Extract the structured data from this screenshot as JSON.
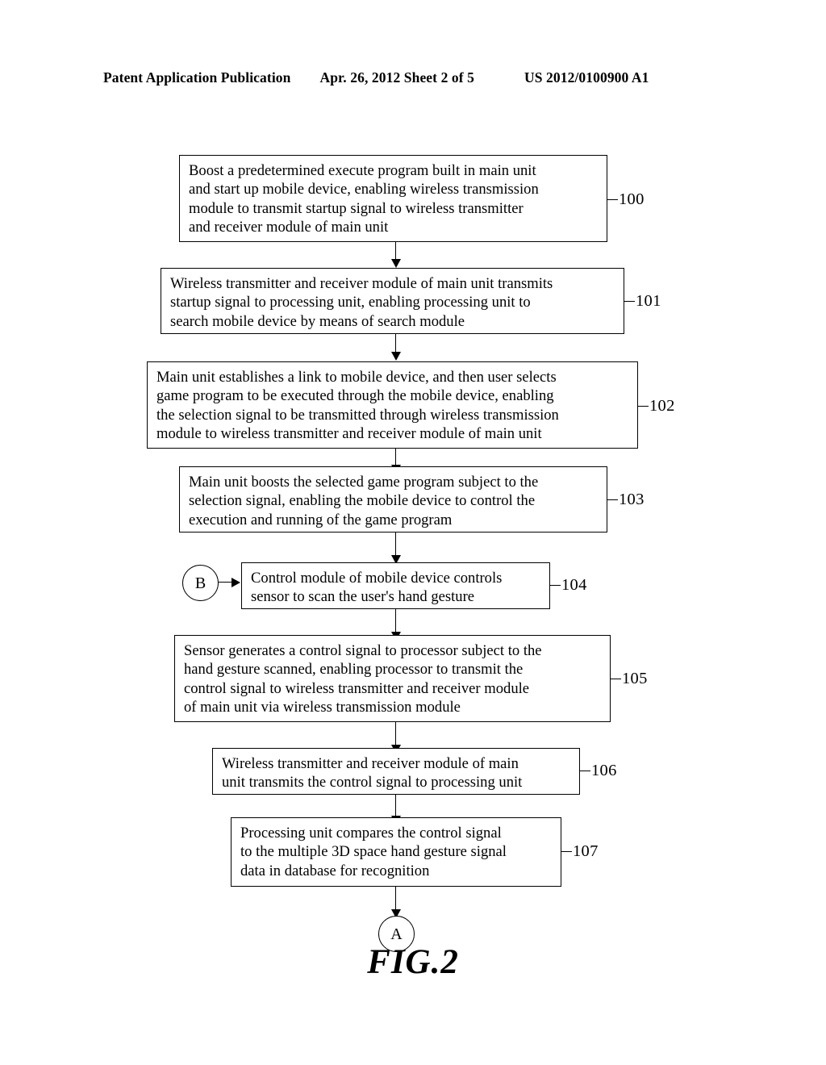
{
  "header": {
    "publication": "Patent Application Publication",
    "date_sheet": "Apr. 26, 2012  Sheet 2 of 5",
    "patent_number": "US 2012/0100900 A1"
  },
  "figure": {
    "caption": "FIG.2",
    "connector_in_label": "B",
    "connector_out_label": "A"
  },
  "chart_data": {
    "type": "diagram",
    "title": "FIG.2",
    "diagram_kind": "flowchart",
    "nodes": [
      {
        "ref": "100",
        "text": "Boost a predetermined execute program built in main unit\nand start up mobile device, enabling wireless transmission\nmodule to transmit startup signal to wireless transmitter\nand receiver module of main unit"
      },
      {
        "ref": "101",
        "text": "Wireless transmitter and receiver module of main unit transmits\nstartup signal to processing unit, enabling processing unit to\nsearch mobile device by means of search module"
      },
      {
        "ref": "102",
        "text": "Main unit establishes a link to mobile device, and then user selects\ngame program to be executed through the mobile device, enabling\nthe selection signal to be transmitted through wireless transmission\nmodule to wireless transmitter and receiver module of main unit"
      },
      {
        "ref": "103",
        "text": "Main unit boosts the selected game program subject to the\nselection signal, enabling the mobile device to control the\nexecution and running of the game program"
      },
      {
        "ref": "104",
        "text": "Control module of mobile device controls\nsensor to scan the user's hand gesture"
      },
      {
        "ref": "105",
        "text": "Sensor generates a control signal to processor subject to the\nhand gesture scanned, enabling processor to transmit the\ncontrol signal to wireless transmitter and receiver module\nof main unit via wireless transmission module"
      },
      {
        "ref": "106",
        "text": "Wireless transmitter and receiver module of main\nunit transmits the control signal to processing unit"
      },
      {
        "ref": "107",
        "text": "Processing unit compares the control signal\nto the multiple 3D space hand gesture signal\ndata in database for recognition"
      }
    ],
    "edges": [
      {
        "from": "100",
        "to": "101",
        "kind": "arrow-down"
      },
      {
        "from": "101",
        "to": "102",
        "kind": "arrow-down"
      },
      {
        "from": "102",
        "to": "103",
        "kind": "arrow-down"
      },
      {
        "from": "103",
        "to": "104",
        "kind": "arrow-down"
      },
      {
        "from": "B",
        "to": "104",
        "kind": "arrow-right"
      },
      {
        "from": "104",
        "to": "105",
        "kind": "arrow-down"
      },
      {
        "from": "105",
        "to": "106",
        "kind": "arrow-down"
      },
      {
        "from": "106",
        "to": "107",
        "kind": "arrow-down"
      },
      {
        "from": "107",
        "to": "A",
        "kind": "arrow-down"
      }
    ],
    "colors": {
      "stroke": "#000000",
      "fill": "#ffffff"
    }
  }
}
